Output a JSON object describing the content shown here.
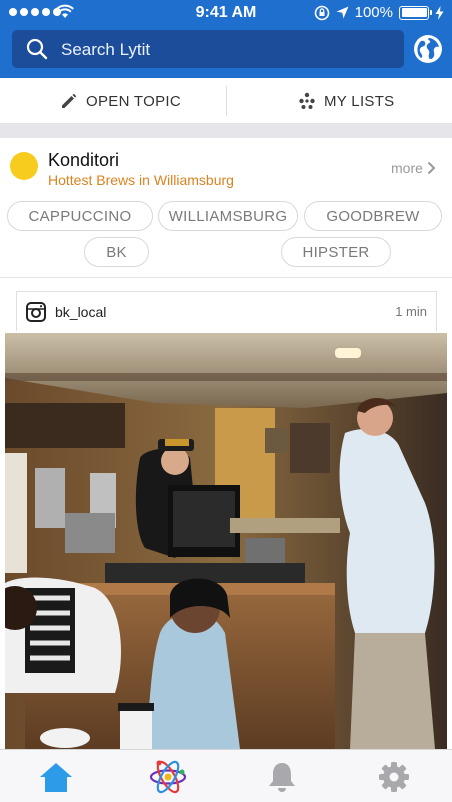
{
  "status_bar": {
    "time": "9:41 AM",
    "battery": "100%"
  },
  "search": {
    "placeholder": "Search Lytit"
  },
  "actions": {
    "open_topic": "OPEN TOPIC",
    "my_lists": "MY LISTS"
  },
  "place": {
    "name": "Konditori",
    "subtitle": "Hottest Brews in Williamsburg",
    "more": "more",
    "tags": [
      "CAPPUCCINO",
      "WILLIAMSBURG",
      "GOODBREW",
      "BK",
      "HIPSTER"
    ]
  },
  "post": {
    "username": "bk_local",
    "time_ago": "1 min"
  },
  "tabs": [
    "home-icon",
    "atom-icon",
    "bell-icon",
    "gear-icon"
  ],
  "colors": {
    "header": "#1f6fcf",
    "search_field": "#1c4d9a",
    "accent": "#d9831f",
    "place_dot": "#f7cc1f",
    "active_tab": "#2d9be8",
    "inactive_tab": "#a9a9ad"
  }
}
